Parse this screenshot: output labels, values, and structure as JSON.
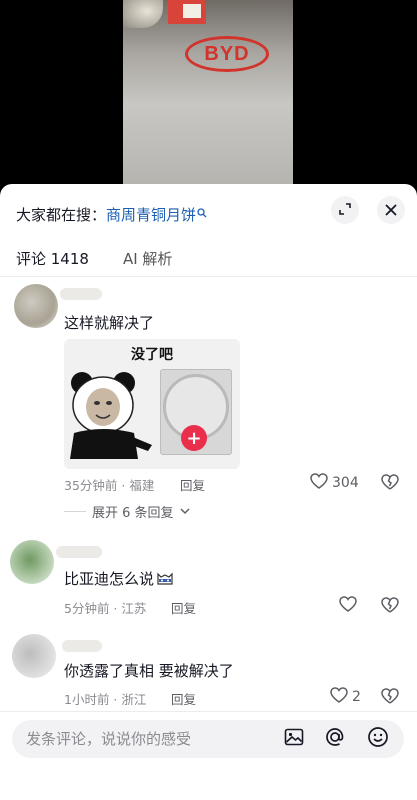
{
  "video": {
    "logo_text": "BYD"
  },
  "header": {
    "search_prefix": "大家都在搜：",
    "search_term": "商周青铜月饼",
    "search_icon": "magnifier-icon",
    "expand_icon": "expand-icon",
    "close_icon": "close-icon"
  },
  "tabs": [
    {
      "label": "评论 1418",
      "active": true
    },
    {
      "label": "AI 解析",
      "active": false
    }
  ],
  "comments": [
    {
      "text": "这样就解决了",
      "sticker_caption": "没了吧",
      "time": "35分钟前 · 福建",
      "reply_label": "回复",
      "likes": "304",
      "expand_label": "展开 6 条回复"
    },
    {
      "text": "比亚迪怎么说",
      "time": "5分钟前 · 江苏",
      "reply_label": "回复",
      "likes": ""
    },
    {
      "text": "你透露了真相 要被解决了",
      "time": "1小时前 · 浙江",
      "reply_label": "回复",
      "likes": "2"
    }
  ],
  "input": {
    "placeholder": "发条评论，说说你的感受",
    "icons": [
      "image-icon",
      "at-icon",
      "emoji-icon"
    ]
  },
  "colors": {
    "accent_blue": "#1a5fb4",
    "plus_red": "#ea2f4c",
    "logo_red": "#d2342b"
  }
}
